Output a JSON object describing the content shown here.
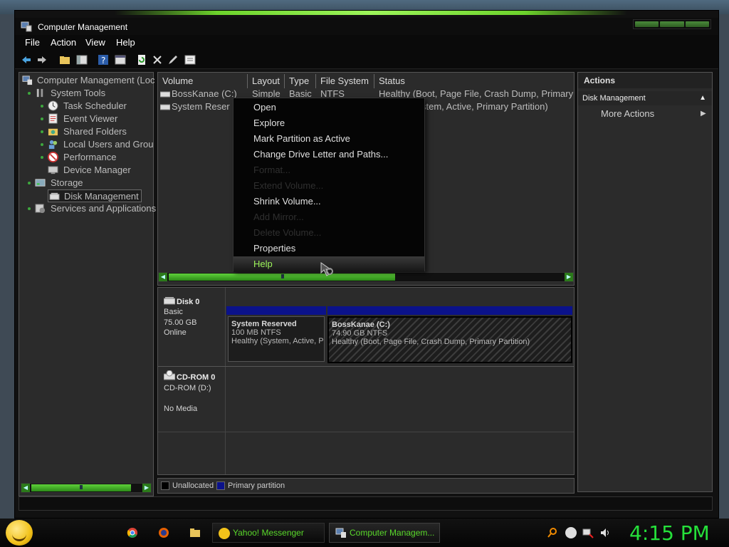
{
  "window": {
    "title": "Computer Management"
  },
  "menu": {
    "file": "File",
    "action": "Action",
    "view": "View",
    "help": "Help"
  },
  "tree": {
    "root": "Computer Management (Loc",
    "system_tools": "System Tools",
    "task_scheduler": "Task Scheduler",
    "event_viewer": "Event Viewer",
    "shared_folders": "Shared Folders",
    "local_users": "Local Users and Grou",
    "performance": "Performance",
    "device_manager": "Device Manager",
    "storage": "Storage",
    "disk_management": "Disk Management",
    "services": "Services and Applications"
  },
  "volumes": {
    "headers": {
      "volume": "Volume",
      "layout": "Layout",
      "type": "Type",
      "filesystem": "File System",
      "status": "Status"
    },
    "rows": [
      {
        "volume": "BossKanae (C:)",
        "layout": "Simple",
        "type": "Basic",
        "filesystem": "NTFS",
        "status": "Healthy (Boot, Page File, Crash Dump, Primary"
      },
      {
        "volume": "System Reser",
        "status": "stem, Active, Primary Partition)"
      }
    ]
  },
  "context_menu": {
    "open": "Open",
    "explore": "Explore",
    "mark_active": "Mark Partition as Active",
    "change_letter": "Change Drive Letter and Paths...",
    "format": "Format...",
    "extend": "Extend Volume...",
    "shrink": "Shrink Volume...",
    "add_mirror": "Add Mirror...",
    "delete": "Delete Volume...",
    "properties": "Properties",
    "help": "Help"
  },
  "disks": {
    "disk0": {
      "name": "Disk 0",
      "type": "Basic",
      "size": "75.00 GB",
      "status": "Online"
    },
    "sysres": {
      "name": "System Reserved",
      "size": "100 MB NTFS",
      "status": "Healthy (System, Active, P"
    },
    "bosskanae": {
      "name": "BossKanae  (C:)",
      "size": "74.90 GB NTFS",
      "status": "Healthy (Boot, Page File, Crash Dump, Primary Partition)"
    },
    "cdrom": {
      "name": "CD-ROM 0",
      "drive": "CD-ROM (D:)",
      "status": "No Media"
    }
  },
  "legend": {
    "unallocated": "Unallocated",
    "primary": "Primary partition"
  },
  "actions": {
    "header": "Actions",
    "section": "Disk Management",
    "more": "More Actions"
  },
  "taskbar": {
    "yahoo": "Yahoo! Messenger",
    "compmgmt": "Computer Managem...",
    "clock": "4:15 PM"
  },
  "colors": {
    "accent": "#59d82a",
    "primary_partition": "#0b128a",
    "clock": "#25e03a"
  }
}
